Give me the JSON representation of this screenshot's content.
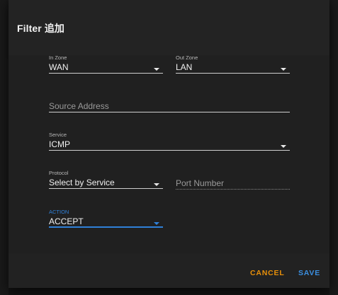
{
  "dialog": {
    "title": "Filter 追加"
  },
  "form": {
    "in_zone": {
      "label": "In Zone",
      "value": "WAN"
    },
    "out_zone": {
      "label": "Out Zone",
      "value": "LAN"
    },
    "source_address": {
      "placeholder": "Source Address",
      "value": ""
    },
    "service": {
      "label": "Service",
      "value": "ICMP"
    },
    "protocol": {
      "label": "Protocol",
      "value": "Select by Service"
    },
    "port_number": {
      "placeholder": "Port Number",
      "value": ""
    },
    "action": {
      "label": "ACTION",
      "value": "ACCEPT"
    }
  },
  "buttons": {
    "cancel": "CANCEL",
    "save": "SAVE"
  },
  "colors": {
    "accent": "#2f80d8",
    "cancel": "#e8900a",
    "save": "#3b8fe0",
    "dialog_bg": "#222222"
  },
  "icons": {
    "dropdown": "chevron-down-icon"
  }
}
